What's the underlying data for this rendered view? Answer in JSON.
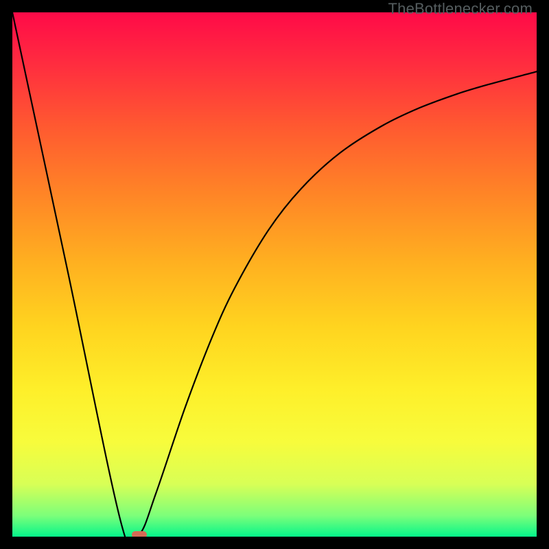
{
  "watermark": "TheBottlenecker.com",
  "colors": {
    "frame": "#000000",
    "gradient_top": "#ff0a48",
    "gradient_bottom": "#05f58a",
    "curve": "#000000",
    "marker": "#d46a55",
    "watermark_text": "#555d5f"
  },
  "chart_data": {
    "type": "line",
    "title": "",
    "xlabel": "",
    "ylabel": "",
    "xlim": [
      0,
      100
    ],
    "ylim": [
      0,
      100
    ],
    "series": [
      {
        "name": "bottleneck-curve",
        "x": [
          0,
          10.5,
          20.9,
          24.2,
          27.4,
          32.9,
          38.0,
          42.4,
          48.8,
          55.1,
          62.5,
          70.6,
          77.7,
          85.0,
          91.0,
          100
        ],
        "values": [
          100,
          50.9,
          2.0,
          0.4,
          8.3,
          24.5,
          37.8,
          47.4,
          58.4,
          66.4,
          73.2,
          78.4,
          81.8,
          84.5,
          86.3,
          88.7
        ]
      }
    ],
    "marker": {
      "x": 24.2,
      "y": 0.4
    },
    "legend": false,
    "grid": false
  }
}
